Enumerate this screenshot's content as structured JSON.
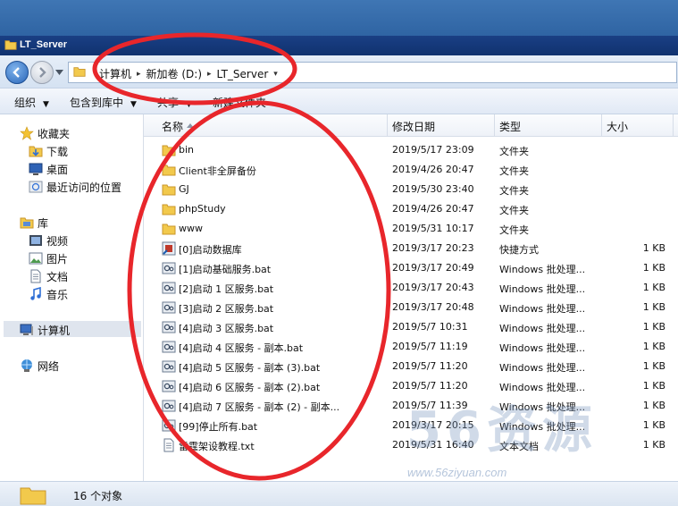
{
  "window": {
    "title": "LT_Server"
  },
  "address": {
    "crumbs": [
      "计算机",
      "新加卷 (D:)",
      "LT_Server"
    ]
  },
  "toolbar": {
    "organize": "组织",
    "include_library": "包含到库中",
    "share": "共享",
    "new_folder": "新建文件夹"
  },
  "nav": {
    "favorites": "收藏夹",
    "favorites_items": [
      "下载",
      "桌面",
      "最近访问的位置"
    ],
    "libraries": "库",
    "library_items": [
      "视频",
      "图片",
      "文档",
      "音乐"
    ],
    "computer": "计算机",
    "network": "网络"
  },
  "columns": {
    "name": "名称",
    "date": "修改日期",
    "type": "类型",
    "size": "大小"
  },
  "files": [
    {
      "name": "bin",
      "date": "2019/5/17 23:09",
      "type": "文件夹",
      "size": "",
      "icon": "folder-icon"
    },
    {
      "name": "Client非全屏备份",
      "date": "2019/4/26 20:47",
      "type": "文件夹",
      "size": "",
      "icon": "folder-icon"
    },
    {
      "name": "GJ",
      "date": "2019/5/30 23:40",
      "type": "文件夹",
      "size": "",
      "icon": "folder-icon"
    },
    {
      "name": "phpStudy",
      "date": "2019/4/26 20:47",
      "type": "文件夹",
      "size": "",
      "icon": "folder-icon"
    },
    {
      "name": "www",
      "date": "2019/5/31 10:17",
      "type": "文件夹",
      "size": "",
      "icon": "folder-icon"
    },
    {
      "name": "[0]启动数据库",
      "date": "2019/3/17 20:23",
      "type": "快捷方式",
      "size": "1 KB",
      "icon": "shortcut-icon"
    },
    {
      "name": "[1]启动基础服务.bat",
      "date": "2019/3/17 20:49",
      "type": "Windows 批处理...",
      "size": "1 KB",
      "icon": "batch-file-icon"
    },
    {
      "name": "[2]启动 1 区服务.bat",
      "date": "2019/3/17 20:43",
      "type": "Windows 批处理...",
      "size": "1 KB",
      "icon": "batch-file-icon"
    },
    {
      "name": "[3]启动 2 区服务.bat",
      "date": "2019/3/17 20:48",
      "type": "Windows 批处理...",
      "size": "1 KB",
      "icon": "batch-file-icon"
    },
    {
      "name": "[4]启动 3 区服务.bat",
      "date": "2019/5/7 10:31",
      "type": "Windows 批处理...",
      "size": "1 KB",
      "icon": "batch-file-icon"
    },
    {
      "name": "[4]启动 4 区服务 - 副本.bat",
      "date": "2019/5/7 11:19",
      "type": "Windows 批处理...",
      "size": "1 KB",
      "icon": "batch-file-icon"
    },
    {
      "name": "[4]启动 5 区服务 - 副本 (3).bat",
      "date": "2019/5/7 11:20",
      "type": "Windows 批处理...",
      "size": "1 KB",
      "icon": "batch-file-icon"
    },
    {
      "name": "[4]启动 6 区服务 - 副本 (2).bat",
      "date": "2019/5/7 11:20",
      "type": "Windows 批处理...",
      "size": "1 KB",
      "icon": "batch-file-icon"
    },
    {
      "name": "[4]启动 7 区服务 - 副本 (2) - 副本...",
      "date": "2019/5/7 11:39",
      "type": "Windows 批处理...",
      "size": "1 KB",
      "icon": "batch-file-icon"
    },
    {
      "name": "[99]停止所有.bat",
      "date": "2019/3/17 20:15",
      "type": "Windows 批处理...",
      "size": "1 KB",
      "icon": "batch-file-icon"
    },
    {
      "name": "雷霆架设教程.txt",
      "date": "2019/5/31 16:40",
      "type": "文本文档",
      "size": "1 KB",
      "icon": "text-file-icon"
    }
  ],
  "status": {
    "count": "16 个对象"
  },
  "watermark": {
    "text": "56资源",
    "url": "www.56ziyuan.com"
  },
  "colors": {
    "title_bar": "#10326f",
    "desktop": "#2f64a3",
    "annotation": "#e8262b"
  }
}
